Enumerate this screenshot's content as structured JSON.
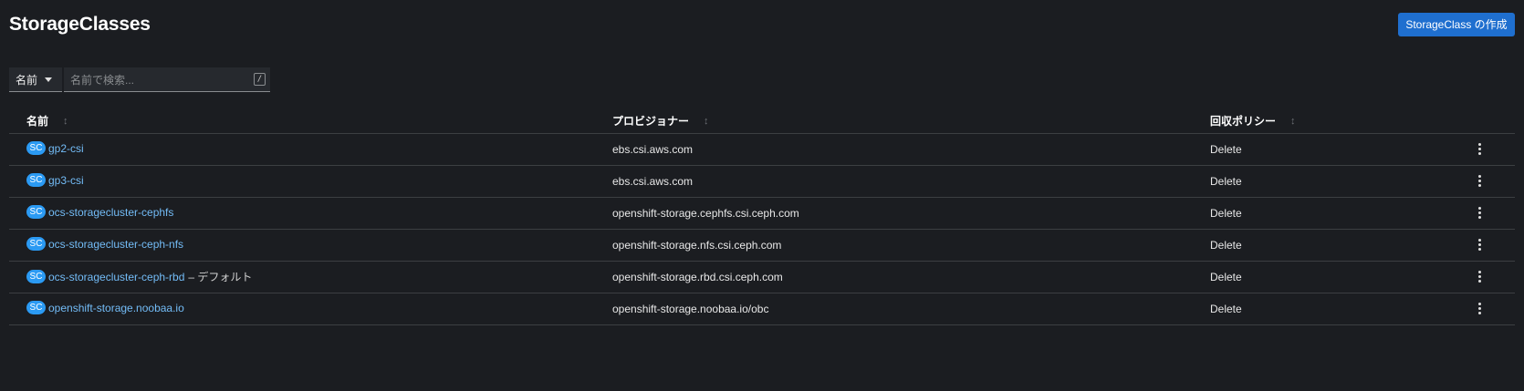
{
  "page": {
    "title": "StorageClasses",
    "create_button": "StorageClass の作成"
  },
  "filter": {
    "selected": "名前",
    "search_placeholder": "名前で検索...",
    "shortcut": "/"
  },
  "table": {
    "columns": [
      "名前",
      "プロビジョナー",
      "回収ポリシー"
    ],
    "badge": "SC",
    "rows": [
      {
        "name": "gp2-csi",
        "default_label": "",
        "provisioner": "ebs.csi.aws.com",
        "policy": "Delete"
      },
      {
        "name": "gp3-csi",
        "default_label": "",
        "provisioner": "ebs.csi.aws.com",
        "policy": "Delete"
      },
      {
        "name": "ocs-storagecluster-cephfs",
        "default_label": "",
        "provisioner": "openshift-storage.cephfs.csi.ceph.com",
        "policy": "Delete"
      },
      {
        "name": "ocs-storagecluster-ceph-nfs",
        "default_label": "",
        "provisioner": "openshift-storage.nfs.csi.ceph.com",
        "policy": "Delete"
      },
      {
        "name": "ocs-storagecluster-ceph-rbd",
        "default_label": "– デフォルト",
        "provisioner": "openshift-storage.rbd.csi.ceph.com",
        "policy": "Delete"
      },
      {
        "name": "openshift-storage.noobaa.io",
        "default_label": "",
        "provisioner": "openshift-storage.noobaa.io/obc",
        "policy": "Delete"
      }
    ]
  },
  "colors": {
    "background": "#1b1d21",
    "primary_button": "#1f6fcf",
    "link": "#73bcf7",
    "badge": "#2b9af3"
  },
  "icons": {
    "filter_caret": "caret-down-icon",
    "sort": "sort-icon",
    "row_actions": "kebab-icon"
  }
}
